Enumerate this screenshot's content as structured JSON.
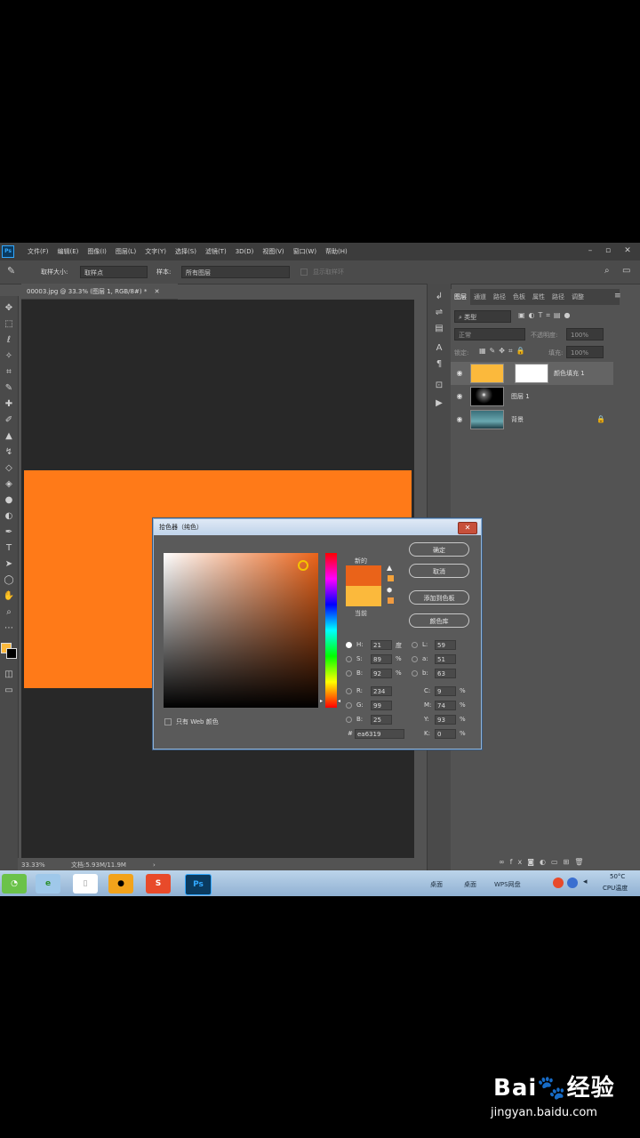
{
  "app": {
    "logo": "Ps",
    "menu": [
      "文件(F)",
      "编辑(E)",
      "图像(I)",
      "图层(L)",
      "文字(Y)",
      "选择(S)",
      "滤镜(T)",
      "3D(D)",
      "视图(V)",
      "窗口(W)",
      "帮助(H)"
    ]
  },
  "options": {
    "sample_size_label": "取样大小:",
    "sample_size_value": "取样点",
    "sample_label": "样本:",
    "sample_value": "所有图层",
    "show_ring": "显示取样环"
  },
  "document": {
    "tab": "00003.jpg @ 33.3% (图层 1, RGB/8#) *",
    "zoom": "33.33%",
    "doc_info": "文档:5.93M/11.9M"
  },
  "layers_panel": {
    "tabs": [
      "图层",
      "通道",
      "路径",
      "色板",
      "属性",
      "路径",
      "调整"
    ],
    "filter_placeholder": "类型",
    "blend_mode": "正常",
    "opacity_label": "不透明度:",
    "opacity_value": "100%",
    "lock_label": "锁定:",
    "fill_label": "填充:",
    "fill_value": "100%",
    "layers": [
      {
        "name": "颜色填充 1"
      },
      {
        "name": "图层 1"
      },
      {
        "name": "背景"
      }
    ]
  },
  "color_picker": {
    "title": "拾色器（纯色）",
    "new_label": "新的",
    "current_label": "当前",
    "new_color": "#ea6319",
    "current_color": "#fbb93c",
    "buttons": {
      "ok": "确定",
      "cancel": "取消",
      "add_swatch": "添加到色板",
      "libraries": "颜色库"
    },
    "web_only": "只有 Web 颜色",
    "hsb": {
      "h": "21",
      "h_unit": "度",
      "s": "89",
      "s_unit": "%",
      "b": "92",
      "b_unit": "%"
    },
    "rgb": {
      "r": "234",
      "g": "99",
      "b": "25"
    },
    "lab": {
      "l": "59",
      "a": "51",
      "b": "63"
    },
    "cmyk": {
      "c": "9",
      "m": "74",
      "y": "93",
      "k": "0",
      "unit": "%"
    },
    "hex": "ea6319"
  },
  "taskbar": {
    "items": [
      "桌面",
      "桌面",
      "WPS网盘"
    ],
    "temp": "50°C",
    "cpu": "CPU温度"
  },
  "watermark": {
    "logo": "Bai🐾经验",
    "url": "jingyan.baidu.com"
  }
}
